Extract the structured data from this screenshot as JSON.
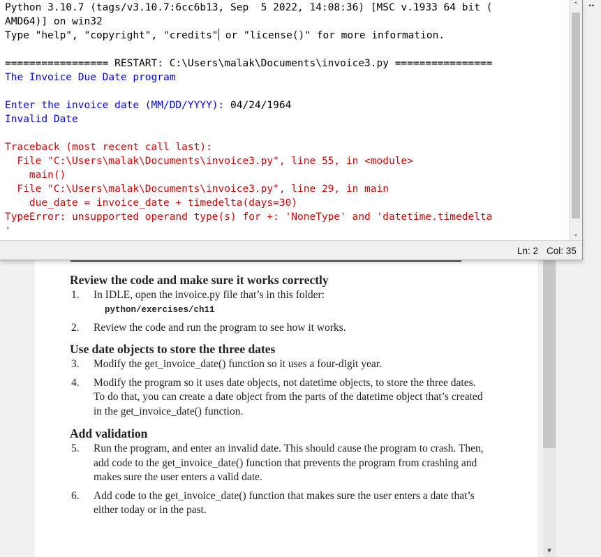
{
  "shell": {
    "lines": [
      {
        "segments": [
          {
            "t": "Python 3.10.7 (tags/v3.10.7:6cc6b13, Sep  5 2022, 14:08:36) [MSC v.1933 64 bit (",
            "c": "black"
          }
        ]
      },
      {
        "segments": [
          {
            "t": "AMD64)] on win32",
            "c": "black"
          }
        ]
      },
      {
        "segments": [
          {
            "t": "Type \"help\", \"copyright\", \"credits\"",
            "c": "black"
          },
          {
            "cursor": true
          },
          {
            "t": " or \"license()\" for more information.",
            "c": "black"
          }
        ]
      },
      {
        "segments": [
          {
            "t": "",
            "c": "black"
          }
        ]
      },
      {
        "segments": [
          {
            "t": "================= RESTART: C:\\Users\\malak\\Documents\\invoice3.py ================",
            "c": "black"
          }
        ]
      },
      {
        "segments": [
          {
            "t": "The Invoice Due Date program",
            "c": "blue"
          }
        ]
      },
      {
        "segments": [
          {
            "t": "",
            "c": "black"
          }
        ]
      },
      {
        "segments": [
          {
            "t": "Enter the invoice date (MM/DD/YYYY): ",
            "c": "blue"
          },
          {
            "t": "04/24/1964",
            "c": "black"
          }
        ]
      },
      {
        "segments": [
          {
            "t": "Invalid Date",
            "c": "blue"
          }
        ]
      },
      {
        "segments": [
          {
            "t": "",
            "c": "black"
          }
        ]
      },
      {
        "segments": [
          {
            "t": "Traceback (most recent call last):",
            "c": "red"
          }
        ]
      },
      {
        "segments": [
          {
            "t": "  File \"C:\\Users\\malak\\Documents\\invoice3.py\", line 55, in <module>",
            "c": "red"
          }
        ]
      },
      {
        "segments": [
          {
            "t": "    main()",
            "c": "red"
          }
        ]
      },
      {
        "segments": [
          {
            "t": "  File \"C:\\Users\\malak\\Documents\\invoice3.py\", line 29, in main",
            "c": "red"
          }
        ]
      },
      {
        "segments": [
          {
            "t": "    due_date = invoice_date + timedelta(days=30)",
            "c": "red"
          }
        ]
      },
      {
        "segments": [
          {
            "t": "TypeError: unsupported operand type(s) for +: 'NoneType' and 'datetime.timedelta",
            "c": "red"
          }
        ]
      },
      {
        "segments": [
          {
            "t": "'",
            "c": "red"
          }
        ]
      }
    ],
    "scroll_up_icon": "chevron-up-icon",
    "scroll_down_icon": "chevron-down-icon"
  },
  "status": {
    "ln": "Ln: 2",
    "col": "Col: 35"
  },
  "colors": {
    "black": "#000000",
    "blue": "#0000ff",
    "red": "#e00000"
  },
  "more_icon": "more-icon",
  "document": {
    "sections": [
      {
        "heading": "Review the code and make sure it works correctly",
        "items": [
          {
            "num": "1.",
            "text": "In IDLE, open the invoice.py file that’s in this folder:",
            "code": "python/exercises/ch11"
          },
          {
            "num": "2.",
            "text": "Review the code and run the program to see how it works."
          }
        ]
      },
      {
        "heading": "Use date objects to store the three dates",
        "items": [
          {
            "num": "3.",
            "text": "Modify the get_invoice_date() function so it uses a four-digit year."
          },
          {
            "num": "4.",
            "text": "Modify the program so it uses date objects, not datetime objects, to store the three dates. To do that, you can create a date object from the parts of the datetime object that’s created in the get_invoice_date() function."
          }
        ]
      },
      {
        "heading": "Add validation",
        "items": [
          {
            "num": "5.",
            "text": "Run the program, and enter an invalid date. This should cause the program to crash. Then, add code to the get_invoice_date() function that prevents the program from crashing and makes sure the user enters a valid date."
          },
          {
            "num": "6.",
            "text": "Add code to the get_invoice_date() function that makes sure the user enters a date that’s either today or in the past."
          }
        ]
      }
    ]
  }
}
